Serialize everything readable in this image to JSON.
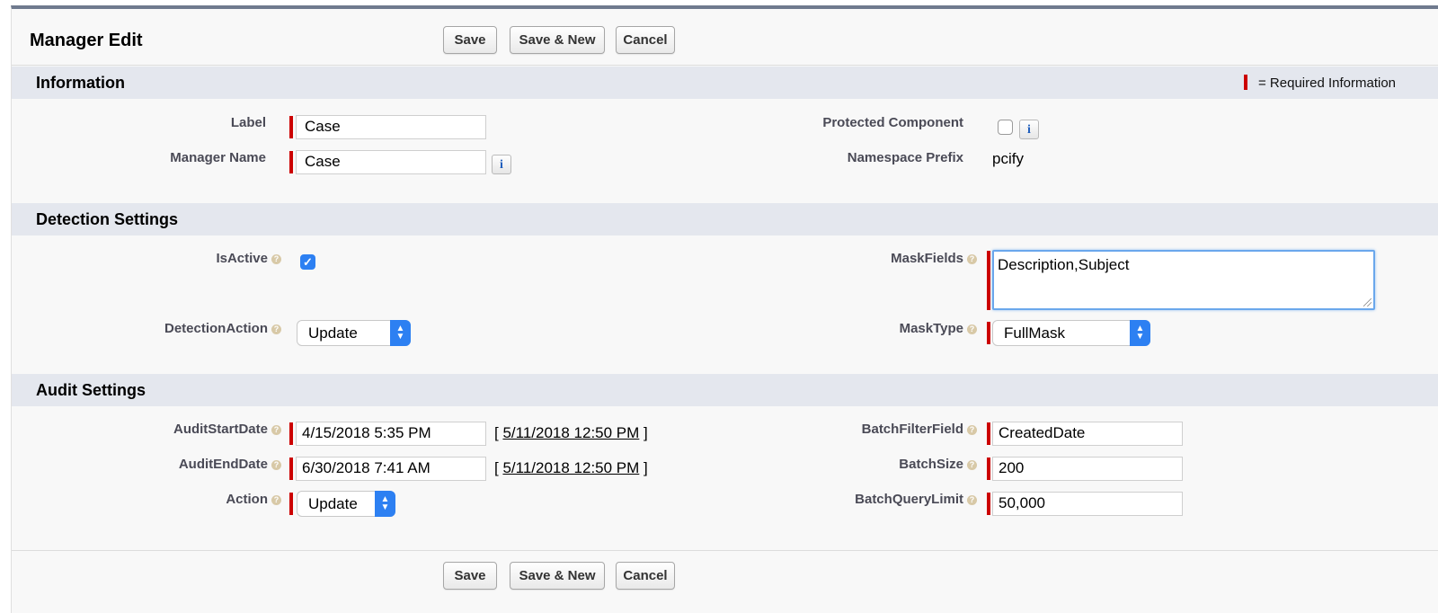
{
  "header": {
    "title": "Manager Edit",
    "buttons": {
      "save": "Save",
      "save_new": "Save & New",
      "cancel": "Cancel"
    }
  },
  "sections": {
    "information": {
      "title": "Information",
      "required_legend": "= Required Information",
      "label_field": {
        "label": "Label",
        "value": "Case"
      },
      "manager_name": {
        "label": "Manager Name",
        "value": "Case",
        "info_icon": "i"
      },
      "protected_component": {
        "label": "Protected Component",
        "checked": false,
        "info_icon": "i"
      },
      "namespace_prefix": {
        "label": "Namespace Prefix",
        "value": "pcify"
      }
    },
    "detection": {
      "title": "Detection Settings",
      "is_active": {
        "label": "IsActive",
        "checked": true
      },
      "detection_action": {
        "label": "DetectionAction",
        "value": "Update"
      },
      "mask_fields": {
        "label": "MaskFields",
        "value": "Description,Subject"
      },
      "mask_type": {
        "label": "MaskType",
        "value": "FullMask"
      }
    },
    "audit": {
      "title": "Audit Settings",
      "audit_start_date": {
        "label": "AuditStartDate",
        "value": "4/15/2018 5:35 PM",
        "link": "5/11/2018 12:50 PM"
      },
      "audit_end_date": {
        "label": "AuditEndDate",
        "value": "6/30/2018 7:41 AM",
        "link": "5/11/2018 12:50 PM"
      },
      "action": {
        "label": "Action",
        "value": "Update"
      },
      "batch_filter_field": {
        "label": "BatchFilterField",
        "value": "CreatedDate"
      },
      "batch_size": {
        "label": "BatchSize",
        "value": "200"
      },
      "batch_query_limit": {
        "label": "BatchQueryLimit",
        "value": "50,000"
      }
    }
  },
  "footer": {
    "buttons": {
      "save": "Save",
      "save_new": "Save & New",
      "cancel": "Cancel"
    }
  },
  "colors": {
    "required": "#cc0000",
    "accent": "#2d80f2",
    "section_bg": "#e4e7ee",
    "top_border": "#6f7a8e"
  }
}
